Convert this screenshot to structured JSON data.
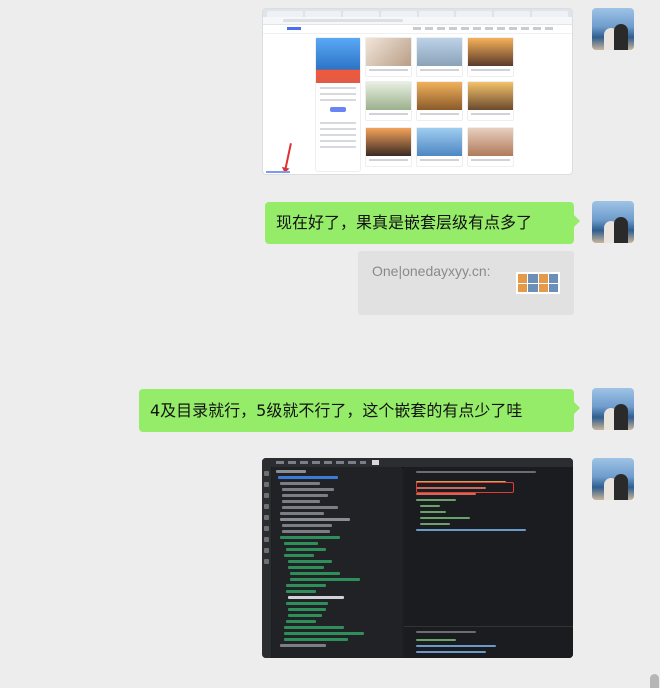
{
  "messages": [
    {
      "type": "image",
      "description_name": "browser-screenshot"
    },
    {
      "type": "text",
      "text": "现在好了，果真是嵌套层级有点多了"
    },
    {
      "type": "link-card",
      "title": "One|onedayxyy.cn:"
    },
    {
      "type": "text",
      "text": "4及目录就行，5级就不行了，这个嵌套的有点少了哇"
    },
    {
      "type": "image",
      "description_name": "editor-screenshot"
    }
  ],
  "colors": {
    "bubble": "#95ec69",
    "background": "#ededed",
    "link_card": "#e1e1e1",
    "annotation_red": "#e53935"
  }
}
